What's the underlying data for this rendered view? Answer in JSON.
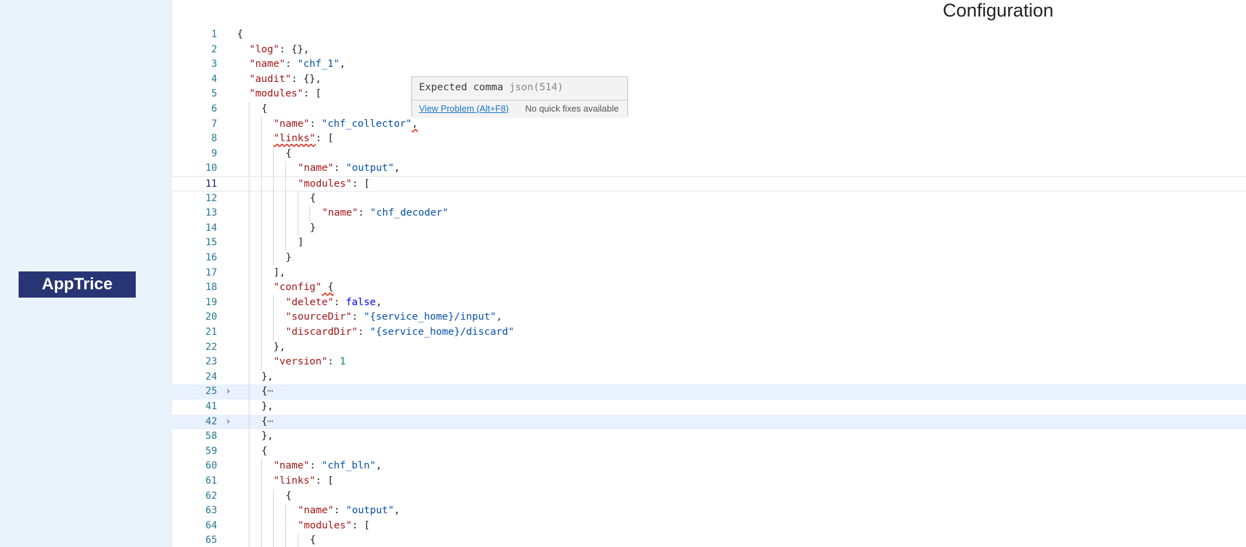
{
  "app": {
    "logo_text": "AppTrice",
    "page_title": "Configuration"
  },
  "colors": {
    "sidebar_bg": "#e9f3fc",
    "logo_bg": "#283575",
    "key": "#a31515",
    "string": "#0451a5",
    "boolean": "#0000ff",
    "number": "#098658",
    "line_number": "#237893",
    "error_squiggle": "#e51400"
  },
  "editor": {
    "lines": [
      {
        "num": "1",
        "depth": 0,
        "tokens": [
          {
            "t": "{",
            "c": "p"
          }
        ]
      },
      {
        "num": "2",
        "depth": 1,
        "tokens": [
          {
            "t": "\"log\"",
            "c": "k"
          },
          {
            "t": ": {},",
            "c": "p"
          }
        ]
      },
      {
        "num": "3",
        "depth": 1,
        "tokens": [
          {
            "t": "\"name\"",
            "c": "k"
          },
          {
            "t": ": ",
            "c": "p"
          },
          {
            "t": "\"chf_1\"",
            "c": "s"
          },
          {
            "t": ",",
            "c": "p"
          }
        ]
      },
      {
        "num": "4",
        "depth": 1,
        "tokens": [
          {
            "t": "\"audit\"",
            "c": "k"
          },
          {
            "t": ": {},",
            "c": "p"
          }
        ]
      },
      {
        "num": "5",
        "depth": 1,
        "tokens": [
          {
            "t": "\"modules\"",
            "c": "k"
          },
          {
            "t": ": [",
            "c": "p"
          }
        ]
      },
      {
        "num": "6",
        "depth": 2,
        "tokens": [
          {
            "t": "{",
            "c": "p"
          }
        ]
      },
      {
        "num": "7",
        "depth": 3,
        "tokens": [
          {
            "t": "\"name\"",
            "c": "k"
          },
          {
            "t": ": ",
            "c": "p"
          },
          {
            "t": "\"chf_collector\"",
            "c": "s"
          },
          {
            "t": ",",
            "c": "p sq"
          }
        ]
      },
      {
        "num": "8",
        "depth": 3,
        "tokens": [
          {
            "t": "\"links\"",
            "c": "k sq"
          },
          {
            "t": ": [",
            "c": "p"
          }
        ]
      },
      {
        "num": "9",
        "depth": 4,
        "tokens": [
          {
            "t": "{",
            "c": "p"
          }
        ]
      },
      {
        "num": "10",
        "depth": 5,
        "tokens": [
          {
            "t": "\"name\"",
            "c": "k"
          },
          {
            "t": ": ",
            "c": "p"
          },
          {
            "t": "\"output\"",
            "c": "s"
          },
          {
            "t": ",",
            "c": "p"
          }
        ]
      },
      {
        "num": "11",
        "depth": 5,
        "current": true,
        "tokens": [
          {
            "t": "\"modules\"",
            "c": "k"
          },
          {
            "t": ": [",
            "c": "p"
          }
        ]
      },
      {
        "num": "12",
        "depth": 6,
        "tokens": [
          {
            "t": "{",
            "c": "p"
          }
        ]
      },
      {
        "num": "13",
        "depth": 7,
        "tokens": [
          {
            "t": "\"name\"",
            "c": "k"
          },
          {
            "t": ": ",
            "c": "p"
          },
          {
            "t": "\"chf_decoder\"",
            "c": "s"
          }
        ]
      },
      {
        "num": "14",
        "depth": 6,
        "tokens": [
          {
            "t": "}",
            "c": "p"
          }
        ]
      },
      {
        "num": "15",
        "depth": 5,
        "tokens": [
          {
            "t": "]",
            "c": "p"
          }
        ]
      },
      {
        "num": "16",
        "depth": 4,
        "tokens": [
          {
            "t": "}",
            "c": "p"
          }
        ]
      },
      {
        "num": "17",
        "depth": 3,
        "tokens": [
          {
            "t": "],",
            "c": "p"
          }
        ]
      },
      {
        "num": "18",
        "depth": 3,
        "tokens": [
          {
            "t": "\"config\"",
            "c": "k"
          },
          {
            "t": " {",
            "c": "p sq"
          }
        ]
      },
      {
        "num": "19",
        "depth": 4,
        "tokens": [
          {
            "t": "\"delete\"",
            "c": "k"
          },
          {
            "t": ": ",
            "c": "p"
          },
          {
            "t": "false",
            "c": "b"
          },
          {
            "t": ",",
            "c": "p"
          }
        ]
      },
      {
        "num": "20",
        "depth": 4,
        "tokens": [
          {
            "t": "\"sourceDir\"",
            "c": "k"
          },
          {
            "t": ": ",
            "c": "p"
          },
          {
            "t": "\"{service_home}/input\"",
            "c": "s"
          },
          {
            "t": ",",
            "c": "p"
          }
        ]
      },
      {
        "num": "21",
        "depth": 4,
        "tokens": [
          {
            "t": "\"discardDir\"",
            "c": "k"
          },
          {
            "t": ": ",
            "c": "p"
          },
          {
            "t": "\"{service_home}/discard\"",
            "c": "s"
          }
        ]
      },
      {
        "num": "22",
        "depth": 3,
        "tokens": [
          {
            "t": "},",
            "c": "p"
          }
        ]
      },
      {
        "num": "23",
        "depth": 3,
        "tokens": [
          {
            "t": "\"version\"",
            "c": "k"
          },
          {
            "t": ": ",
            "c": "p"
          },
          {
            "t": "1",
            "c": "n"
          }
        ]
      },
      {
        "num": "24",
        "depth": 2,
        "tokens": [
          {
            "t": "},",
            "c": "p"
          }
        ]
      },
      {
        "num": "25",
        "depth": 2,
        "folded": true,
        "tokens": [
          {
            "t": "{",
            "c": "p"
          },
          {
            "t": "⋯",
            "c": "ell"
          }
        ]
      },
      {
        "num": "41",
        "depth": 2,
        "tokens": [
          {
            "t": "},",
            "c": "p"
          }
        ]
      },
      {
        "num": "42",
        "depth": 2,
        "folded": true,
        "tokens": [
          {
            "t": "{",
            "c": "p"
          },
          {
            "t": "⋯",
            "c": "ell"
          }
        ]
      },
      {
        "num": "58",
        "depth": 2,
        "tokens": [
          {
            "t": "},",
            "c": "p"
          }
        ]
      },
      {
        "num": "59",
        "depth": 2,
        "tokens": [
          {
            "t": "{",
            "c": "p"
          }
        ]
      },
      {
        "num": "60",
        "depth": 3,
        "tokens": [
          {
            "t": "\"name\"",
            "c": "k"
          },
          {
            "t": ": ",
            "c": "p"
          },
          {
            "t": "\"chf_bln\"",
            "c": "s"
          },
          {
            "t": ",",
            "c": "p"
          }
        ]
      },
      {
        "num": "61",
        "depth": 3,
        "tokens": [
          {
            "t": "\"links\"",
            "c": "k"
          },
          {
            "t": ": [",
            "c": "p"
          }
        ]
      },
      {
        "num": "62",
        "depth": 4,
        "tokens": [
          {
            "t": "{",
            "c": "p"
          }
        ]
      },
      {
        "num": "63",
        "depth": 5,
        "tokens": [
          {
            "t": "\"name\"",
            "c": "k"
          },
          {
            "t": ": ",
            "c": "p"
          },
          {
            "t": "\"output\"",
            "c": "s"
          },
          {
            "t": ",",
            "c": "p"
          }
        ]
      },
      {
        "num": "64",
        "depth": 5,
        "tokens": [
          {
            "t": "\"modules\"",
            "c": "k"
          },
          {
            "t": ": [",
            "c": "p"
          }
        ]
      },
      {
        "num": "65",
        "depth": 6,
        "tokens": [
          {
            "t": "{",
            "c": "p"
          }
        ]
      }
    ]
  },
  "hover_tooltip": {
    "message": "Expected comma",
    "code": "json(514)",
    "view_problem_label": "View Problem (Alt+F8)",
    "no_fixes_label": "No quick fixes available"
  }
}
